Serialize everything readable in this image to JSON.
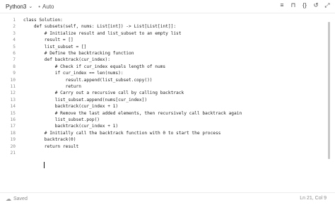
{
  "toolbar": {
    "language": "Python3",
    "mode": "Auto",
    "icons": [
      "format-icon",
      "bookmark-icon",
      "braces-icon",
      "reset-icon",
      "fullscreen-icon"
    ]
  },
  "editor": {
    "lines": [
      {
        "n": "1",
        "text": "class Solution:"
      },
      {
        "n": "2",
        "text": "    def subsets(self, nums: List[int]) -> List[List[int]]:"
      },
      {
        "n": "3",
        "text": "        # Initialize result and list_subset to an empty list"
      },
      {
        "n": "4",
        "text": "        result = []"
      },
      {
        "n": "5",
        "text": "        list_subset = []"
      },
      {
        "n": "6",
        "text": "        # Define the backtracking function"
      },
      {
        "n": "7",
        "text": "        def backtrack(cur_index):"
      },
      {
        "n": "8",
        "text": "            # Check if cur_index equals length of nums"
      },
      {
        "n": "9",
        "text": "            if cur_index == len(nums):"
      },
      {
        "n": "10",
        "text": "                result.append(list_subset.copy())"
      },
      {
        "n": "11",
        "text": "                return"
      },
      {
        "n": "12",
        "text": "            # Carry out a recursive call by calling backtrack"
      },
      {
        "n": "13",
        "text": "            list_subset.append(nums[cur_index])"
      },
      {
        "n": "14",
        "text": "            backtrack(cur_index + 1)"
      },
      {
        "n": "15",
        "text": "            # Remove the last added elements, then recursively call backtrack again"
      },
      {
        "n": "16",
        "text": "            list_subset.pop()"
      },
      {
        "n": "17",
        "text": "            backtrack(cur_index + 1)"
      },
      {
        "n": "18",
        "text": "        # Initially call the backtrack function with 0 to start the process"
      },
      {
        "n": "19",
        "text": "        backtrack(0)"
      },
      {
        "n": "20",
        "text": "        return result"
      },
      {
        "n": "21",
        "text": ""
      }
    ]
  },
  "status": {
    "saved": "Saved",
    "position": "Ln 21, Col 9"
  }
}
